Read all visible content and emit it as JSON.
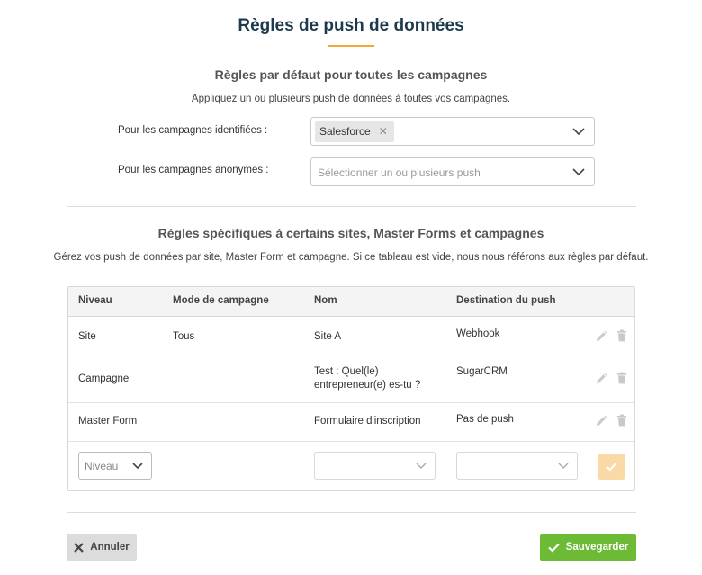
{
  "page": {
    "title": "Règles de push de données"
  },
  "defaults": {
    "title": "Règles par défaut pour toutes les campagnes",
    "description": "Appliquez un ou plusieurs push de données à toutes vos campagnes.",
    "identified": {
      "label": "Pour les campagnes identifiées :",
      "selected_tag": "Salesforce"
    },
    "anonymous": {
      "label": "Pour les campagnes anonymes :",
      "placeholder": "Sélectionner un ou plusieurs push"
    }
  },
  "specific": {
    "title": "Règles spécifiques à certains sites, Master Forms et campagnes",
    "description": "Gérez vos push de données par site, Master Form et campagne. Si ce tableau est vide, nous nous référons aux règles par défaut.",
    "columns": [
      "Niveau",
      "Mode de campagne",
      "Nom",
      "Destination du push"
    ],
    "rows": [
      {
        "niveau": "Site",
        "mode": "Tous",
        "nom": "Site A",
        "destination": "Webhook"
      },
      {
        "niveau": "Campagne",
        "mode": "",
        "nom": "Test : Quel(le) entrepreneur(e) es-tu ?",
        "destination": "SugarCRM"
      },
      {
        "niveau": "Master Form",
        "mode": "",
        "nom": "Formulaire d'inscription",
        "destination": "Pas de push"
      }
    ],
    "new_row": {
      "niveau_placeholder": "Niveau"
    }
  },
  "actions": {
    "cancel_label": "Annuler",
    "save_label": "Sauvegarder"
  },
  "colors": {
    "accent": "#f2a93b",
    "title": "#1d3a4d",
    "save": "#6dbb35",
    "confirm_disabled": "#fbd9a6"
  }
}
